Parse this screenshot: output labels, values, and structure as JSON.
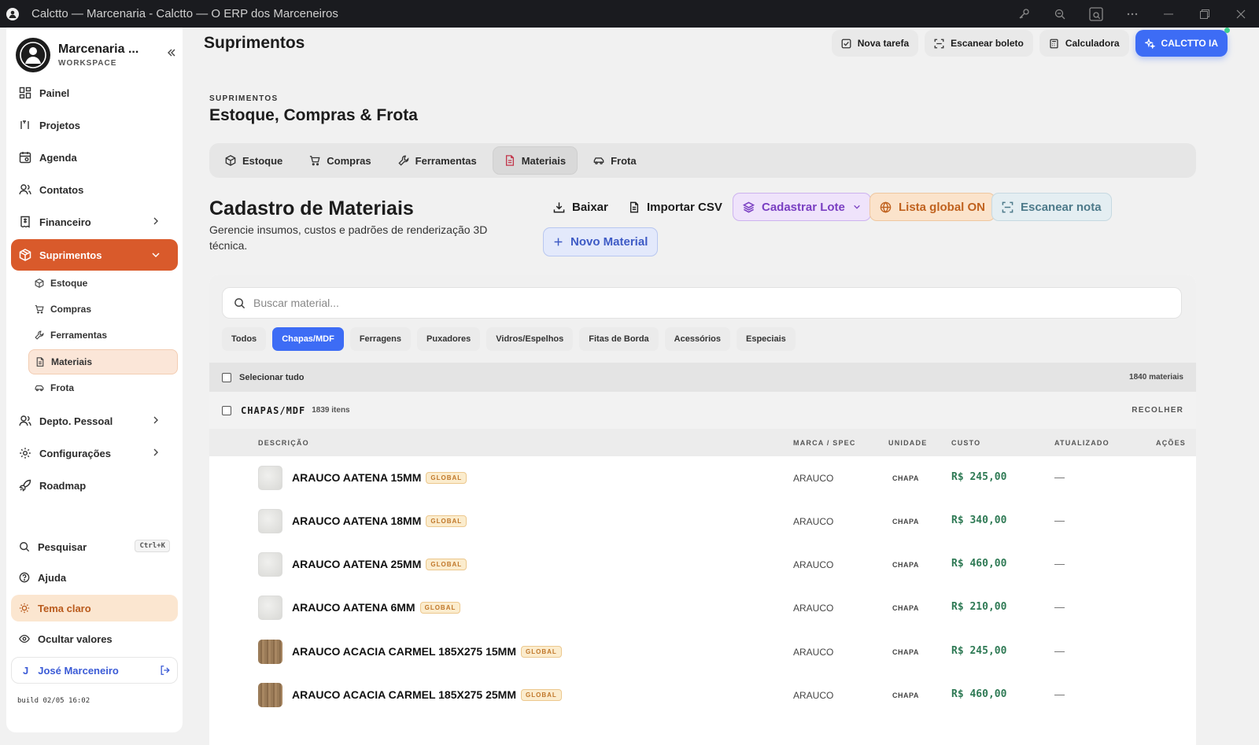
{
  "window": {
    "title": "Calctto — Marcenaria - Calctto — O ERP dos Marceneiros"
  },
  "workspace": {
    "name": "Marcenaria ...",
    "label": "WORKSPACE"
  },
  "sidebar": {
    "nav": [
      {
        "label": "Painel",
        "icon": "grid-icon"
      },
      {
        "label": "Projetos",
        "icon": "tools-icon"
      },
      {
        "label": "Agenda",
        "icon": "calendar-icon"
      },
      {
        "label": "Contatos",
        "icon": "users-icon"
      },
      {
        "label": "Financeiro",
        "icon": "receipt-icon"
      },
      {
        "label": "Suprimentos",
        "icon": "box-icon"
      }
    ],
    "sub": [
      {
        "label": "Estoque",
        "icon": "box-icon"
      },
      {
        "label": "Compras",
        "icon": "cart-icon"
      },
      {
        "label": "Ferramentas",
        "icon": "wrench-icon"
      },
      {
        "label": "Materiais",
        "icon": "file-icon"
      },
      {
        "label": "Frota",
        "icon": "car-icon"
      }
    ],
    "nav2": [
      {
        "label": "Depto. Pessoal",
        "icon": "users-icon"
      },
      {
        "label": "Configurações",
        "icon": "gear-icon"
      },
      {
        "label": "Roadmap",
        "icon": "rocket-icon"
      }
    ],
    "search_label": "Pesquisar",
    "search_kbd": "Ctrl+K",
    "help_label": "Ajuda",
    "theme_label": "Tema claro",
    "hide_label": "Ocultar valores",
    "user_initial": "J",
    "user_name": "José Marceneiro",
    "build": "build 02/05 16:02"
  },
  "header": {
    "title": "Suprimentos",
    "buttons": [
      "Nova tarefa",
      "Escanear boleto",
      "Calculadora",
      "CALCTTO IA"
    ]
  },
  "page": {
    "eyebrow": "SUPRIMENTOS",
    "title": "Estoque, Compras & Frota",
    "tabs": [
      "Estoque",
      "Compras",
      "Ferramentas",
      "Materiais",
      "Frota"
    ]
  },
  "section": {
    "title": "Cadastro de Materiais",
    "desc": "Gerencie insumos, custos e padrões de renderização 3D técnica.",
    "actions": {
      "baixar": "Baixar",
      "importar": "Importar CSV",
      "lote": "Cadastrar Lote",
      "global": "Lista global ON",
      "scan": "Escanear nota",
      "novo": "Novo Material"
    }
  },
  "search": {
    "placeholder": "Buscar material..."
  },
  "filters": [
    "Todos",
    "Chapas/MDF",
    "Ferragens",
    "Puxadores",
    "Vidros/Espelhos",
    "Fitas de Borda",
    "Acessórios",
    "Especiais"
  ],
  "active_filter": "Chapas/MDF",
  "list": {
    "select_all": "Selecionar tudo",
    "total": "1840 materiais",
    "group": {
      "name": "CHAPAS/MDF",
      "count": "1839 itens",
      "collapse": "RECOLHER"
    },
    "columns": {
      "desc": "DESCRIÇÃO",
      "brand": "MARCA / SPEC",
      "unit": "UNIDADE",
      "cost": "CUSTO",
      "updated": "ATUALIZADO",
      "actions": "AÇÕES"
    },
    "rows": [
      {
        "name": "ARAUCO AATENA 15MM",
        "badge": "GLOBAL",
        "brand": "ARAUCO",
        "unit": "CHAPA",
        "cost": "R$ 245,00",
        "updated": "—",
        "swatch": "#e4e4e2"
      },
      {
        "name": "ARAUCO AATENA 18MM",
        "badge": "GLOBAL",
        "brand": "ARAUCO",
        "unit": "CHAPA",
        "cost": "R$ 340,00",
        "updated": "—",
        "swatch": "#e4e4e2"
      },
      {
        "name": "ARAUCO AATENA 25MM",
        "badge": "GLOBAL",
        "brand": "ARAUCO",
        "unit": "CHAPA",
        "cost": "R$ 460,00",
        "updated": "—",
        "swatch": "#e4e4e2"
      },
      {
        "name": "ARAUCO AATENA 6MM",
        "badge": "GLOBAL",
        "brand": "ARAUCO",
        "unit": "CHAPA",
        "cost": "R$ 210,00",
        "updated": "—",
        "swatch": "#e4e4e2"
      },
      {
        "name": "ARAUCO ACACIA CARMEL 185X275 15MM",
        "badge": "GLOBAL",
        "brand": "ARAUCO",
        "unit": "CHAPA",
        "cost": "R$ 245,00",
        "updated": "—",
        "swatch": "#9a7b58"
      },
      {
        "name": "ARAUCO ACACIA CARMEL 185X275 25MM",
        "badge": "GLOBAL",
        "brand": "ARAUCO",
        "unit": "CHAPA",
        "cost": "R$ 460,00",
        "updated": "—",
        "swatch": "#9a7b58"
      }
    ]
  },
  "colors": {
    "accent": "#d95a2b",
    "primary": "#3d6cf5",
    "money": "#2f7a55"
  }
}
